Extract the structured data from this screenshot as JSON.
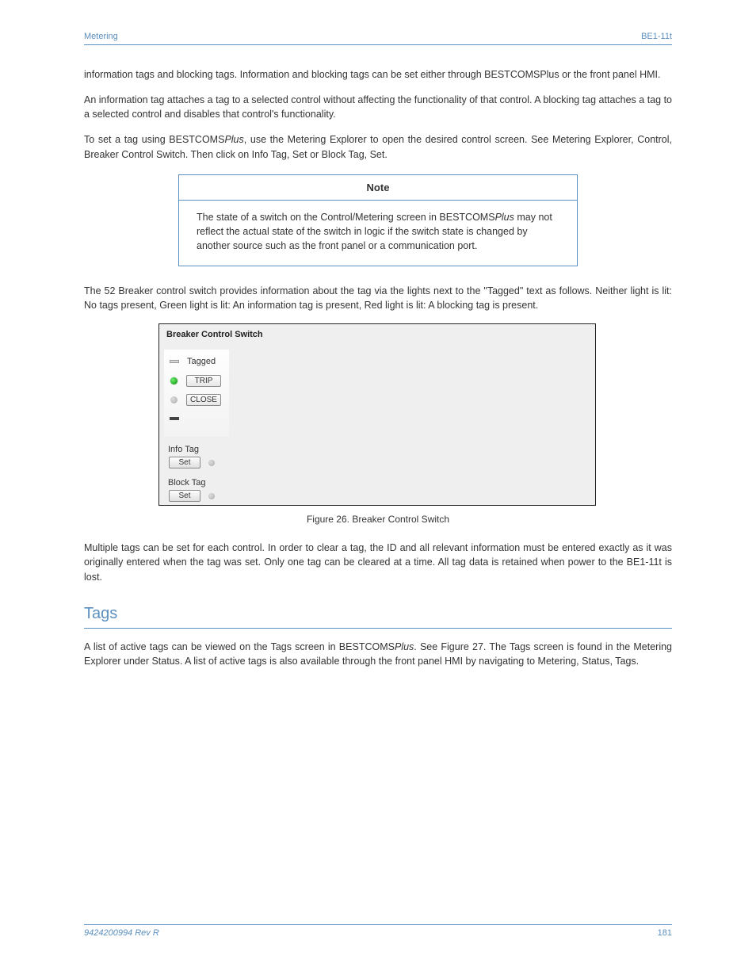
{
  "header": {
    "left": "Metering",
    "right": "BE1-11t"
  },
  "paragraphs": {
    "p1": "information tags and blocking tags. Information and blocking tags can be set either through BESTCOMSPlus or the front panel HMI.",
    "p2": "An information tag attaches a tag to a selected control without affecting the functionality of that control. A blocking tag attaches a tag to a selected control and disables that control's functionality.",
    "p3": "Metering Explorer, Control, Breaker Control Switch. Then click on Info Tag, Set or Block Tag, Set.",
    "p3_prefix": "To set a tag using BESTCOMS",
    "p3_plus": "Plus",
    "p3_after": ", use the Metering Explorer to open the desired control screen. See ",
    "h3": "The 52 Breaker control switch provides information about the tag via the lights next to the \"Tagged\" text as follows. Neither light is lit: No tags present, Green light is lit: An information tag is present, Red light is lit: A blocking tag is present.",
    "h3_suffix": "",
    "p4": "Multiple tags can be set for each control. In order to clear a tag, the ID and all relevant information must be entered exactly as it was originally entered when the tag was set. Only one tag can be cleared at a time. All tag data is retained when power to the BE1-11t is lost.",
    "p5": "A list of active tags can be viewed on the Tags screen in BESTCOMSPlus. See Figure 27. The Tags screen is found in the Metering Explorer under Status. A list of active tags is also available through the front panel HMI by navigating to Metering, Status, Tags.",
    "p5_prefix": "A list of active tags can be viewed on the Tags screen in BESTCOMS",
    "p5_after": ". See Figure 27. The Tags screen is found in the Metering Explorer under Status. A list of active tags is also available through the front panel HMI by navigating to Metering, Status, Tags."
  },
  "note": {
    "head": "Note",
    "body": "The state of a switch on the Control/Metering screen in BESTCOMSPlus may not reflect the actual state of the switch in logic if the switch state is changed by another source such as the front panel or a communication port.",
    "body_prefix": "The state of a switch on the Control/Metering screen in BESTCOMS",
    "body_after": " may not reflect the actual state of the switch in logic if the switch state is changed by another source such as the front panel or a communication port."
  },
  "figure": {
    "title": "Breaker Control Switch",
    "tagged": "Tagged",
    "trip": "TRIP",
    "close": "CLOSE",
    "info_label": "Info Tag",
    "block_label": "Block Tag",
    "set": "Set",
    "caption": "Figure 26. Breaker Control Switch"
  },
  "section": {
    "h2": "Tags",
    "body_prefix": "A list of active tags can be viewed on the Tags screen in BESTCOMS",
    "body_after": ". See Figure 27. The Tags screen is found in the Metering Explorer under Status. A list of active tags is also available through the front panel HMI by navigating to Metering, Status, Tags."
  },
  "footer": {
    "left": "9424200994 Rev R",
    "right": "181"
  },
  "plus_ital": "Plus"
}
